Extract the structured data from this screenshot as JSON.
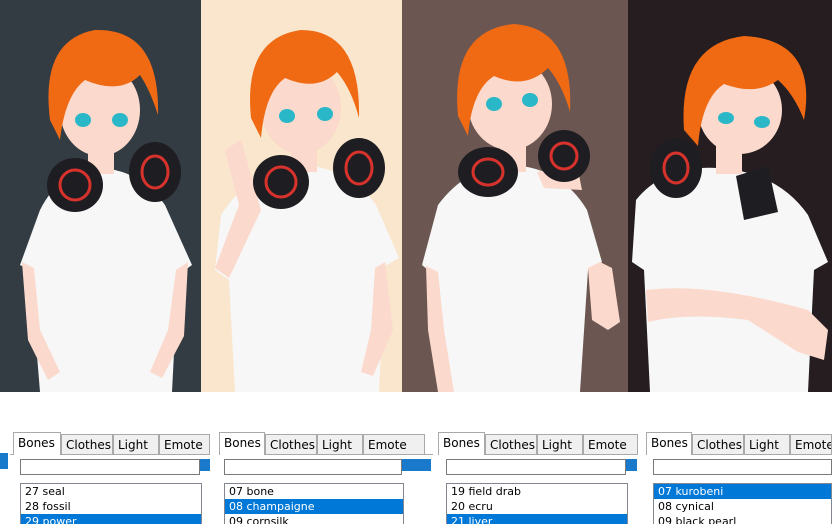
{
  "panels": [
    {
      "bg": "#333b43",
      "pose": "arms-down"
    },
    {
      "bg": "#f9e6cc",
      "pose": "hand-on-head"
    },
    {
      "bg": "#6b5651",
      "pose": "pointing-to-self"
    },
    {
      "bg": "#251d20",
      "pose": "arms-crossed-head-tilt"
    }
  ],
  "colors": {
    "hair": "#f06a14",
    "skin": "#fbd9cc",
    "shirt": "#f7f7f7",
    "eyes": "#2ab8c9",
    "headphone": "#1e1e22",
    "headphone_accent": "#d8322c",
    "selection": "#0078d7"
  },
  "windows": [
    {
      "tabs": [
        "Bones",
        "Clothes",
        "Light",
        "Emote"
      ],
      "active_tab": "Bones",
      "items": [
        {
          "text": "27  seal",
          "selected": false
        },
        {
          "text": "28  fossil",
          "selected": false
        },
        {
          "text": "29  power",
          "selected": true
        }
      ]
    },
    {
      "tabs": [
        "Bones",
        "Clothes",
        "Light",
        "Emote"
      ],
      "active_tab": "Bones",
      "items": [
        {
          "text": "07  bone",
          "selected": false
        },
        {
          "text": "08  champaigne",
          "selected": true
        },
        {
          "text": "09  cornsilk",
          "selected": false
        }
      ]
    },
    {
      "tabs": [
        "Bones",
        "Clothes",
        "Light",
        "Emote"
      ],
      "active_tab": "Bones",
      "items": [
        {
          "text": "19  field drab",
          "selected": false
        },
        {
          "text": "20  ecru",
          "selected": false
        },
        {
          "text": "21  liver",
          "selected": true
        }
      ]
    },
    {
      "tabs": [
        "Bones",
        "Clothes",
        "Light",
        "Emote"
      ],
      "active_tab": "Bones",
      "items": [
        {
          "text": "07  kurobeni",
          "selected": true
        },
        {
          "text": "08  cynical",
          "selected": false
        },
        {
          "text": "09  black pearl",
          "selected": false
        }
      ]
    }
  ]
}
